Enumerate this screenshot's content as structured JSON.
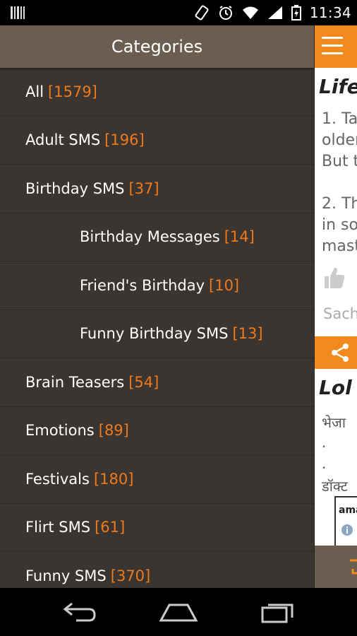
{
  "status_bar": {
    "time": "11:34",
    "icons": [
      "barcode-icon",
      "vibrate-icon",
      "alarm-icon",
      "wifi-icon",
      "signal-icon",
      "battery-charging-icon"
    ]
  },
  "drawer": {
    "title": "Categories",
    "categories": [
      {
        "label": "All",
        "count": "[1579]",
        "level": "top"
      },
      {
        "label": "Adult SMS",
        "count": "[196]",
        "level": "top"
      },
      {
        "label": "Birthday SMS",
        "count": "[37]",
        "level": "top"
      },
      {
        "label": "Birthday Messages",
        "count": "[14]",
        "level": "sub"
      },
      {
        "label": "Friend's Birthday",
        "count": "[10]",
        "level": "sub"
      },
      {
        "label": "Funny Birthday SMS",
        "count": "[13]",
        "level": "sub"
      },
      {
        "label": "Brain Teasers",
        "count": "[54]",
        "level": "top"
      },
      {
        "label": "Emotions",
        "count": "[89]",
        "level": "top"
      },
      {
        "label": "Festivals",
        "count": "[180]",
        "level": "top"
      },
      {
        "label": "Flirt SMS",
        "count": "[61]",
        "level": "top"
      },
      {
        "label": "Funny SMS",
        "count": "[370]",
        "level": "top"
      }
    ]
  },
  "main": {
    "post1": {
      "title": "Life",
      "lines": [
        "1. Ta",
        "older",
        "But t",
        "2. Th",
        "in so",
        "mast"
      ],
      "author": "Sach"
    },
    "post2": {
      "title": "Lol",
      "lines": [
        "भेजा",
        ".",
        ".",
        "डॉक्ट"
      ]
    },
    "ad_text": "ama"
  },
  "colors": {
    "accent_orange": "#f28a1e",
    "count_orange": "#f07a1a",
    "drawer_bg": "#3a3531",
    "drawer_header": "#6b5e50"
  }
}
